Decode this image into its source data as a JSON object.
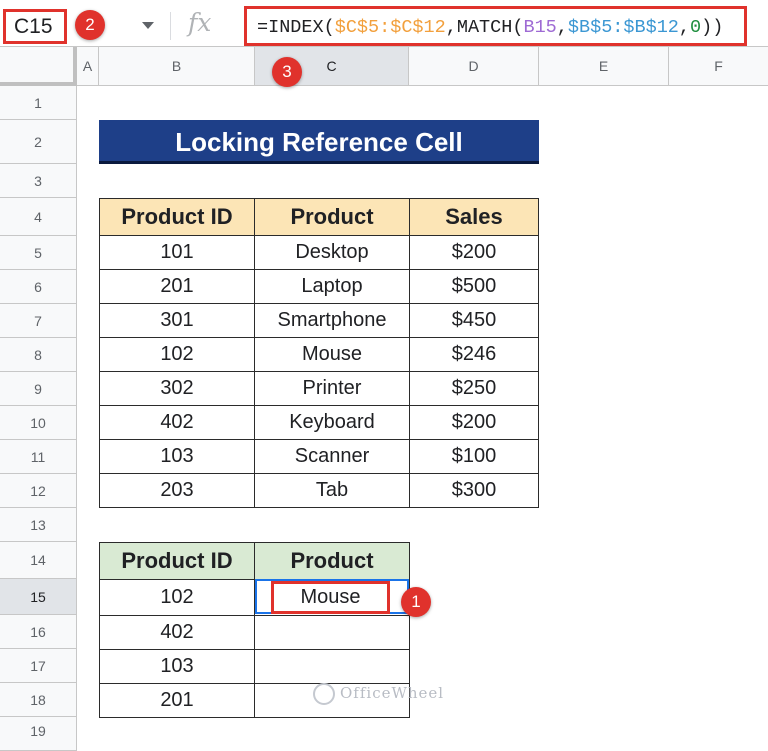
{
  "formula_bar": {
    "name_box": "C15",
    "fx_label": "fx",
    "formula_parts": [
      {
        "text": "=INDEX(",
        "color": "default"
      },
      {
        "text": "$C$5:$C$12",
        "color": "orange"
      },
      {
        "text": ",MATCH(",
        "color": "default"
      },
      {
        "text": "B15",
        "color": "purple"
      },
      {
        "text": ",",
        "color": "default"
      },
      {
        "text": "$B$5:$B$12",
        "color": "blue"
      },
      {
        "text": ",",
        "color": "default"
      },
      {
        "text": "0",
        "color": "green"
      },
      {
        "text": "))",
        "color": "default"
      }
    ]
  },
  "badges": {
    "one": "1",
    "two": "2",
    "three": "3"
  },
  "columns": [
    "A",
    "B",
    "C",
    "D",
    "E",
    "F"
  ],
  "rows": [
    "1",
    "2",
    "3",
    "4",
    "5",
    "6",
    "7",
    "8",
    "9",
    "10",
    "11",
    "12",
    "13",
    "14",
    "15",
    "16",
    "17",
    "18",
    "19"
  ],
  "title": "Locking Reference Cell",
  "main_table": {
    "headers": [
      "Product ID",
      "Product",
      "Sales"
    ],
    "rows": [
      [
        "101",
        "Desktop",
        "$200"
      ],
      [
        "201",
        "Laptop",
        "$500"
      ],
      [
        "301",
        "Smartphone",
        "$450"
      ],
      [
        "102",
        "Mouse",
        "$246"
      ],
      [
        "302",
        "Printer",
        "$250"
      ],
      [
        "402",
        "Keyboard",
        "$200"
      ],
      [
        "103",
        "Scanner",
        "$100"
      ],
      [
        "203",
        "Tab",
        "$300"
      ]
    ]
  },
  "lookup_table": {
    "headers": [
      "Product ID",
      "Product"
    ],
    "rows": [
      [
        "102",
        "Mouse"
      ],
      [
        "402",
        ""
      ],
      [
        "103",
        ""
      ],
      [
        "201",
        ""
      ]
    ]
  },
  "watermark": "OfficeWheel",
  "colors": {
    "title_bg": "#1e3f88",
    "header_orange": "#fce5b6",
    "header_green": "#d9ead3",
    "highlight_red": "#e0322c",
    "selection_blue": "#1a73e8"
  }
}
